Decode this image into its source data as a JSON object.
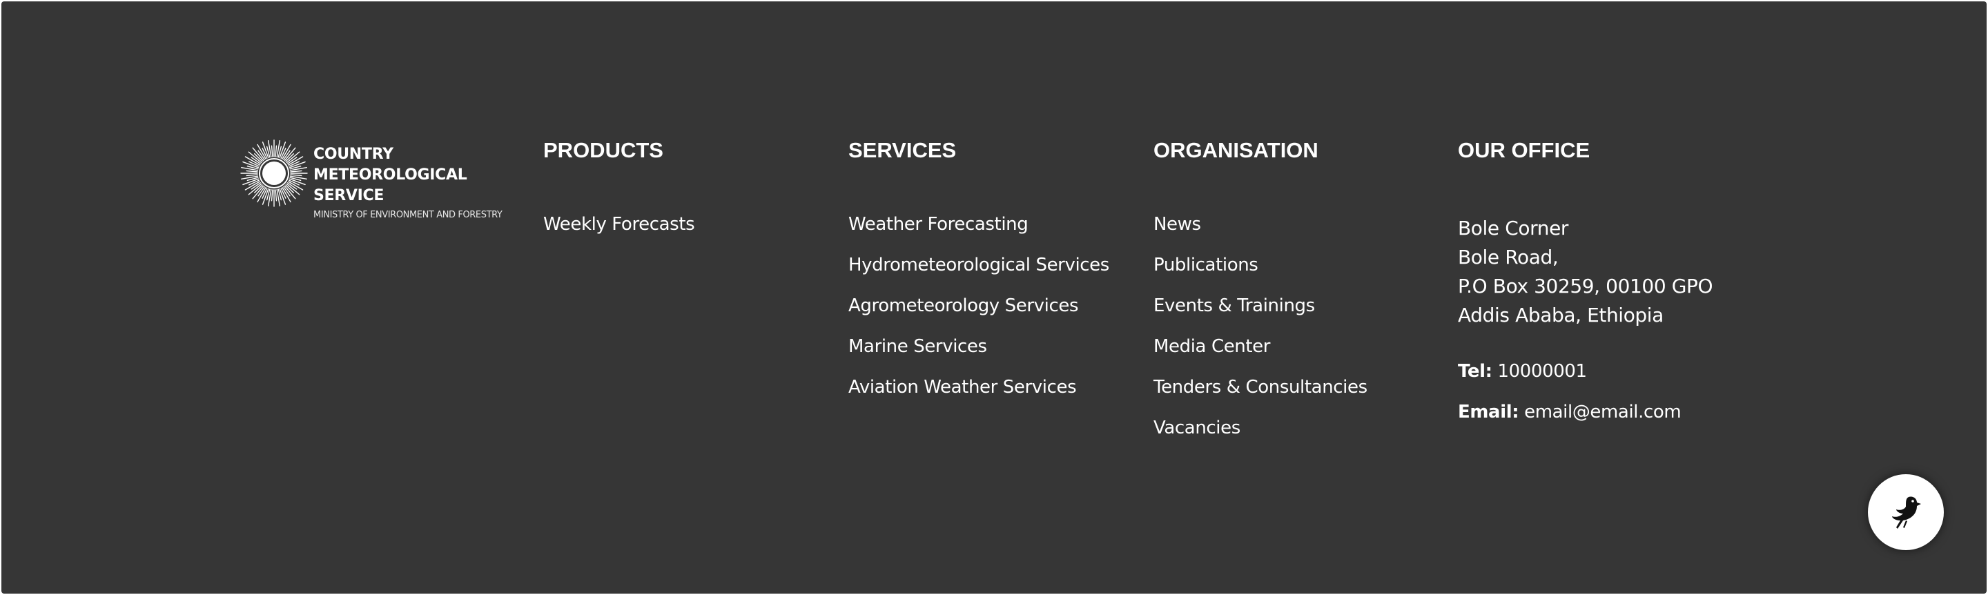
{
  "logo": {
    "name_line1": "COUNTRY METEOROLOGICAL",
    "name_line2": "SERVICE",
    "subtitle": "MINISTRY OF ENVIRONMENT AND FORESTRY",
    "icon": "sun-emblem-icon"
  },
  "products": {
    "heading": "PRODUCTS",
    "items": [
      "Weekly Forecasts"
    ]
  },
  "services": {
    "heading": "SERVICES",
    "items": [
      "Weather Forecasting",
      "Hydrometeorological Services",
      "Agrometeorology Services",
      "Marine Services",
      "Aviation Weather Services"
    ]
  },
  "organisation": {
    "heading": "ORGANISATION",
    "items": [
      "News",
      "Publications",
      "Events & Trainings",
      "Media Center",
      "Tenders & Consultancies",
      "Vacancies"
    ]
  },
  "office": {
    "heading": "OUR OFFICE",
    "address": [
      "Bole Corner",
      "Bole Road,",
      "P.O Box 30259, 00100 GPO",
      "Addis Ababa, Ethiopia"
    ],
    "tel_label": "Tel:",
    "tel_value": "10000001",
    "email_label": "Email:",
    "email_value": "email@email.com"
  },
  "fab": {
    "icon": "bird-icon"
  },
  "colors": {
    "background": "#363636",
    "text": "#ffffff"
  }
}
